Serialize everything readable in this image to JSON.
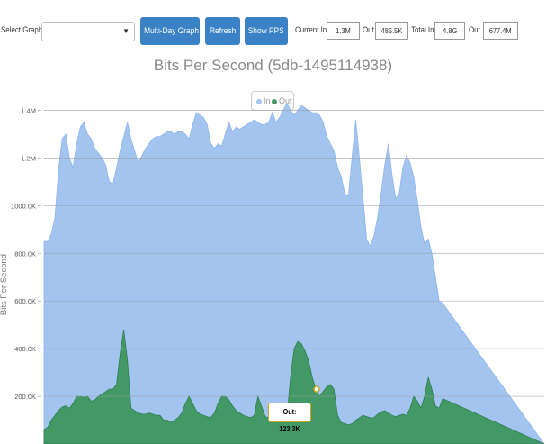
{
  "toolbar": {
    "select_label": "Select Graph:",
    "select_value": "",
    "multi_day_label": "Multi-Day Graph",
    "refresh_label": "Refresh",
    "show_pps_label": "Show PPS",
    "current_in_label": "Current In",
    "current_in_value": "1.3M",
    "current_out_label": "Out",
    "current_out_value": "485.5K",
    "total_in_label": "Total In",
    "total_in_value": "4.8G",
    "total_out_label": "Out",
    "total_out_value": "677.4M"
  },
  "tooltip": {
    "text": "Out: 123.3K"
  },
  "colors": {
    "in": "#a2c4ee",
    "in_line": "#8eb6e9",
    "out": "#439966",
    "out_line": "#2e7d4f",
    "button": "#3a81c6"
  },
  "chart_data": {
    "type": "area",
    "title": "Bits Per Second (5db-1495114938)",
    "ylabel": "Bits Per Second",
    "xlabel": "",
    "ylim": [
      0,
      1500000
    ],
    "yticks": [
      200000,
      400000,
      600000,
      800000,
      1000000,
      1200000,
      1400000
    ],
    "ytick_labels": [
      "200.0K",
      "400.0K",
      "600.0K",
      "800.0K",
      "1000.0K",
      "1.2M",
      "1.4M"
    ],
    "grid": true,
    "legend_position": "top-center",
    "x": [
      0,
      4,
      8,
      12,
      16,
      20,
      24,
      28,
      32,
      36,
      40,
      44,
      48,
      52,
      56,
      60,
      64,
      68,
      72,
      76,
      80,
      84,
      88,
      92,
      96,
      100,
      104,
      108,
      112,
      116,
      120,
      124,
      128,
      132,
      136,
      140,
      144,
      148,
      152,
      156,
      160,
      164,
      168,
      172,
      176,
      180,
      184,
      188,
      192,
      196,
      200,
      204,
      208,
      212,
      216,
      220,
      224,
      228,
      232,
      236,
      240,
      244,
      248,
      252,
      256,
      260,
      264,
      268,
      272,
      276,
      280,
      284,
      288,
      292,
      296,
      300,
      304,
      308,
      312,
      316,
      320,
      324,
      328,
      332,
      336,
      340,
      344,
      348,
      352,
      356,
      360,
      364,
      368,
      372,
      376,
      380,
      384,
      388,
      392,
      396,
      400,
      404,
      408,
      412,
      416,
      420,
      424,
      428,
      432,
      436,
      440,
      444,
      448,
      452,
      456,
      460,
      464,
      468,
      472,
      476,
      480,
      484,
      488,
      492,
      496,
      500,
      504,
      508,
      512,
      516,
      520,
      524,
      528,
      532,
      536,
      540,
      544,
      548,
      552
    ],
    "series": [
      {
        "name": "In",
        "values": [
          850000,
          850000,
          880000,
          950000,
          1150000,
          1280000,
          1300000,
          1200000,
          1160000,
          1260000,
          1330000,
          1350000,
          1300000,
          1280000,
          1240000,
          1220000,
          1200000,
          1170000,
          1100000,
          1090000,
          1160000,
          1230000,
          1290000,
          1350000,
          1280000,
          1230000,
          1180000,
          1210000,
          1240000,
          1260000,
          1280000,
          1290000,
          1290000,
          1300000,
          1310000,
          1310000,
          1300000,
          1310000,
          1310000,
          1300000,
          1280000,
          1340000,
          1390000,
          1380000,
          1370000,
          1340000,
          1260000,
          1240000,
          1260000,
          1250000,
          1300000,
          1350000,
          1310000,
          1330000,
          1320000,
          1330000,
          1340000,
          1350000,
          1360000,
          1350000,
          1340000,
          1340000,
          1350000,
          1390000,
          1350000,
          1370000,
          1400000,
          1430000,
          1400000,
          1380000,
          1400000,
          1420000,
          1410000,
          1400000,
          1390000,
          1390000,
          1380000,
          1350000,
          1290000,
          1260000,
          1230000,
          1160000,
          1120000,
          1050000,
          1040000,
          1210000,
          1360000,
          1200000,
          1030000,
          860000,
          830000,
          870000,
          950000,
          1050000,
          1170000,
          1260000,
          1130000,
          1030000,
          1050000,
          1160000,
          1210000,
          1180000,
          1120000,
          1020000,
          910000,
          840000,
          860000,
          800000,
          700000,
          600000,
          590000
        ]
      },
      {
        "name": "Out",
        "values": [
          60000,
          70000,
          100000,
          120000,
          140000,
          155000,
          160000,
          150000,
          170000,
          200000,
          200000,
          195000,
          200000,
          180000,
          185000,
          200000,
          210000,
          220000,
          230000,
          230000,
          250000,
          380000,
          480000,
          350000,
          150000,
          140000,
          130000,
          125000,
          125000,
          130000,
          125000,
          120000,
          120000,
          100000,
          100000,
          90000,
          100000,
          110000,
          130000,
          170000,
          200000,
          170000,
          140000,
          125000,
          120000,
          115000,
          110000,
          130000,
          170000,
          200000,
          200000,
          185000,
          160000,
          140000,
          130000,
          120000,
          115000,
          110000,
          120000,
          200000,
          160000,
          115000,
          110000,
          105000,
          100000,
          100000,
          100000,
          110000,
          280000,
          400000,
          430000,
          420000,
          390000,
          350000,
          280000,
          230000,
          200000,
          220000,
          240000,
          250000,
          230000,
          120000,
          90000,
          85000,
          80000,
          85000,
          100000,
          110000,
          120000,
          115000,
          110000,
          110000,
          125000,
          135000,
          140000,
          130000,
          120000,
          115000,
          120000,
          125000,
          120000,
          150000,
          200000,
          180000,
          150000,
          200000,
          280000,
          230000,
          160000,
          150000,
          190000
        ]
      }
    ]
  }
}
